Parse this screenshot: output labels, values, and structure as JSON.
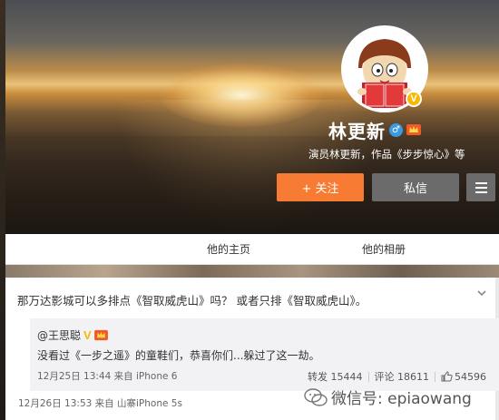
{
  "profile": {
    "name": "林更新",
    "bio": "演员林更新，作品《步步惊心》等",
    "verified_badge": "V",
    "gender_symbol": "♂"
  },
  "actions": {
    "follow_label": "+ 关注",
    "message_label": "私信"
  },
  "tabs": [
    "他的主页",
    "他的相册"
  ],
  "post": {
    "text": "那万达影城可以多排点《智取威虎山》吗？ 或者只排《智取威虎山》。",
    "meta": "12月26日 13:53 来自 山寨iPhone 5s",
    "repost": {
      "user": "@王思聪",
      "verified_mark": "V",
      "text": "没看过《一步之遥》的童鞋们，恭喜你们...躲过了这一劫。",
      "meta": "12月25日 13:44 来自 iPhone 6",
      "reposts_label": "转发 15444",
      "comments_label": "评论 18611",
      "likes": "54596"
    }
  },
  "watermark": "微信号: epiaowang",
  "colors": {
    "follow": "#f77b33",
    "message": "#6b6b6b",
    "verified": "#f6b800"
  }
}
